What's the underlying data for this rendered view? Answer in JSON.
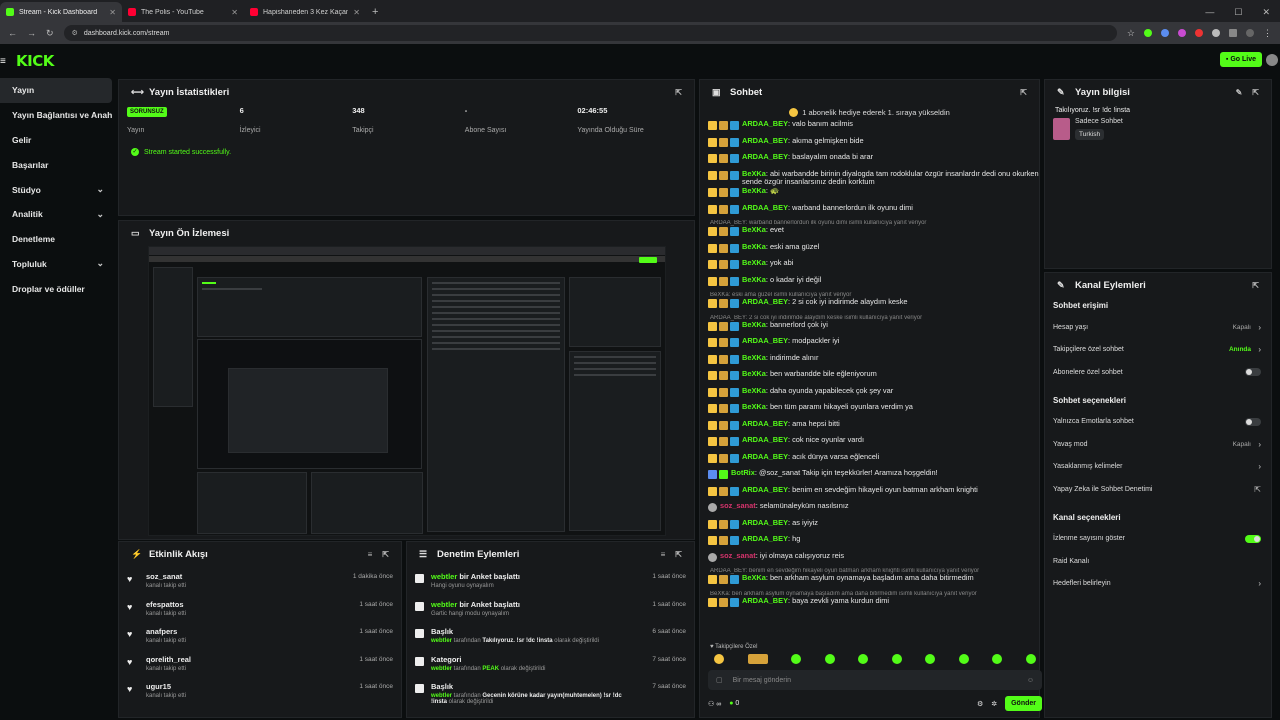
{
  "browser": {
    "tabs": [
      {
        "title": "Stream - Kick Dashboard",
        "color": "#53fc18",
        "active": true
      },
      {
        "title": "The Polis - YouTube",
        "color": "#ff0033",
        "active": false
      },
      {
        "title": "Hapishaneden 3 Kez Kaçan Ad...",
        "color": "#ff0033",
        "active": false
      }
    ],
    "url": "dashboard.kick.com/stream"
  },
  "header": {
    "logo": "KICK",
    "go_live": "Go Live"
  },
  "sidebar": {
    "items": [
      {
        "label": "Yayın",
        "active": true,
        "chevron": false
      },
      {
        "label": "Yayın Bağlantısı ve Anahtarı",
        "chevron": false
      },
      {
        "label": "Gelir",
        "chevron": false
      },
      {
        "label": "Başarılar",
        "chevron": false
      },
      {
        "label": "Stüdyo",
        "chevron": true
      },
      {
        "label": "Analitik",
        "chevron": true
      },
      {
        "label": "Denetleme",
        "chevron": false
      },
      {
        "label": "Topluluk",
        "chevron": true
      },
      {
        "label": "Droplar ve ödüller",
        "chevron": false
      }
    ]
  },
  "stats": {
    "title": "Yayın İstatistikleri",
    "status_badge": "SORUNSUZ",
    "items": [
      {
        "value": "",
        "label": "Yayın"
      },
      {
        "value": "6",
        "label": "İzleyici"
      },
      {
        "value": "348",
        "label": "Takipçi"
      },
      {
        "value": "-",
        "label": "Abone Sayısı"
      },
      {
        "value": "02:46:55",
        "label": "Yayında Olduğu Süre"
      }
    ],
    "success_msg": "Stream started successfully."
  },
  "preview": {
    "title": "Yayın Ön İzlemesi"
  },
  "activity": {
    "title": "Etkinlik Akışı",
    "rows": [
      {
        "name": "soz_sanat",
        "sub": "kanalı takip etti",
        "time": "1 dakika önce"
      },
      {
        "name": "efespattos",
        "sub": "kanalı takip etti",
        "time": "1 saat önce"
      },
      {
        "name": "anafpers",
        "sub": "kanalı takip etti",
        "time": "1 saat önce"
      },
      {
        "name": "qorelith_real",
        "sub": "kanalı takip etti",
        "time": "1 saat önce"
      },
      {
        "name": "ugur15",
        "sub": "kanalı takip etti",
        "time": "1 saat önce"
      }
    ]
  },
  "moderation": {
    "title": "Denetim Eylemleri",
    "rows": [
      {
        "line1_user": "webtler",
        "line1_rest": " bir Anket başlattı",
        "sub": "Hangi oyunu oynayalım",
        "time": "1 saat önce"
      },
      {
        "line1_user": "webtler",
        "line1_rest": " bir Anket başlattı",
        "sub": "Gartic hangi modu oynayalım",
        "time": "1 saat önce"
      },
      {
        "line1_user": "",
        "line1_rest": "Başlık",
        "sub_user": "webtler",
        "sub_mid": " tarafından ",
        "sub_bold": "Takılıyoruz. !sr !dc !insta",
        "sub_end": " olarak değiştirildi",
        "time": "6 saat önce"
      },
      {
        "line1_user": "",
        "line1_rest": "Kategori",
        "sub_user": "webtler",
        "sub_mid": " tarafından ",
        "sub_bold": "PEAK",
        "sub_end": " olarak değiştirildi",
        "time": "7 saat önce"
      },
      {
        "line1_user": "",
        "line1_rest": "Başlık",
        "sub_user": "webtler",
        "sub_mid": " tarafından ",
        "sub_bold": "Gecenin körüne kadar yayın(muhtemelen) !sr !dc !insta",
        "sub_end": " olarak değiştirildi",
        "time": "7 saat önce"
      }
    ]
  },
  "chat": {
    "title": "Sohbet",
    "banner": "1 abonelik hediye ederek 1. sıraya yükseldin",
    "messages": [
      {
        "type": "msg",
        "user": "ARDAA_BEY",
        "cls": "u-a",
        "text": "valo banım acilmis"
      },
      {
        "type": "msg",
        "user": "ARDAA_BEY",
        "cls": "u-a",
        "text": "akıma gelmişken bide"
      },
      {
        "type": "msg",
        "user": "ARDAA_BEY",
        "cls": "u-a",
        "text": "baslayalım onada bi arar"
      },
      {
        "type": "msg",
        "user": "BeXKa",
        "cls": "u-b",
        "text": "abi warbandde birinin diyalogda tam rodoklular özgür insanlardır dedi onu okurken sende özgür insanlarsınız dedin korktum"
      },
      {
        "type": "msg",
        "user": "BeXKa",
        "cls": "u-b",
        "text": "🐢"
      },
      {
        "type": "msg",
        "user": "ARDAA_BEY",
        "cls": "u-a",
        "text": "warband bannerlordun ilk oyunu dimi"
      },
      {
        "type": "reply",
        "text": "ARDAA_BEY: warband bannerlordun ilk oyunu dimi isimli kullanıcıya yanıt veriyor"
      },
      {
        "type": "msg",
        "user": "BeXKa",
        "cls": "u-b",
        "text": "evet"
      },
      {
        "type": "msg",
        "user": "BeXKa",
        "cls": "u-b",
        "text": "eski ama güzel"
      },
      {
        "type": "msg",
        "user": "BeXKa",
        "cls": "u-b",
        "text": "yok abi"
      },
      {
        "type": "msg",
        "user": "BeXKa",
        "cls": "u-b",
        "text": "o kadar iyi değil"
      },
      {
        "type": "reply",
        "text": "BeXKa: eski ama güzel isimli kullanıcıya yanıt veriyor"
      },
      {
        "type": "msg",
        "user": "ARDAA_BEY",
        "cls": "u-a",
        "text": "2 si cok iyi indirimde alaydım keske"
      },
      {
        "type": "reply",
        "text": "ARDAA_BEY: 2 si cok iyi indirimde alaydım keske isimli kullanıcıya yanıt veriyor"
      },
      {
        "type": "msg",
        "user": "BeXKa",
        "cls": "u-b",
        "text": "bannerlord çok iyi"
      },
      {
        "type": "msg",
        "user": "ARDAA_BEY",
        "cls": "u-a",
        "text": "modpackler iyi"
      },
      {
        "type": "msg",
        "user": "BeXKa",
        "cls": "u-b",
        "text": "indirimde alınır"
      },
      {
        "type": "msg",
        "user": "BeXKa",
        "cls": "u-b",
        "text": "ben warbandde bile eğleniyorum"
      },
      {
        "type": "msg",
        "user": "BeXKa",
        "cls": "u-b",
        "text": "daha oyunda yapabilecek çok şey var"
      },
      {
        "type": "msg",
        "user": "BeXKa",
        "cls": "u-b",
        "text": "ben tüm paramı hikayeli oyunlara verdim ya"
      },
      {
        "type": "msg",
        "user": "ARDAA_BEY",
        "cls": "u-a",
        "text": "ama hepsi bitti"
      },
      {
        "type": "msg",
        "user": "ARDAA_BEY",
        "cls": "u-a",
        "text": "cok nice oyunlar vardı"
      },
      {
        "type": "msg",
        "user": "ARDAA_BEY",
        "cls": "u-a",
        "text": "acık dünya varsa eğlenceli"
      },
      {
        "type": "msg",
        "user": "BotRix",
        "cls": "u-bot",
        "text": "@soz_sanat Takip için teşekkürler! Aramıza hoşgeldin!"
      },
      {
        "type": "msg",
        "user": "ARDAA_BEY",
        "cls": "u-a",
        "text": "benim en sevdeğim hikayeli oyun batman arkham knighti"
      },
      {
        "type": "msg",
        "user": "soz_sanat",
        "cls": "u-s",
        "text": "selamünaleyküm nasılsınız"
      },
      {
        "type": "msg",
        "user": "ARDAA_BEY",
        "cls": "u-a",
        "text": "as iyiyiz"
      },
      {
        "type": "msg",
        "user": "ARDAA_BEY",
        "cls": "u-a",
        "text": "hg"
      },
      {
        "type": "msg",
        "user": "soz_sanat",
        "cls": "u-s",
        "text": "iyi olmaya calışıyoruz reis"
      },
      {
        "type": "reply",
        "text": "ARDAA_BEY: benim en sevdeğim hikayeli oyun batman arkham knighti isimli kullanıcıya yanıt veriyor"
      },
      {
        "type": "msg",
        "user": "BeXKa",
        "cls": "u-b",
        "text": "ben arkham asylum oynamaya başladım ama daha bitirmedim"
      },
      {
        "type": "reply",
        "text": "BeXKa: ben arkham asylum oynamaya başladım ama daha bitirmedim isimli kullanıcıya yanıt veriyor"
      },
      {
        "type": "msg",
        "user": "ARDAA_BEY",
        "cls": "u-a",
        "text": "baya zevkli yama kurdun dimi"
      }
    ],
    "followers_only": "Takipçilere Özel",
    "placeholder": "Bir mesaj gönderin",
    "viewers": "0",
    "send_label": "Gönder"
  },
  "info": {
    "title": "Yayın bilgisi",
    "stream_title": "Takılıyoruz. !sr !dc !insta",
    "category": "Sadece Sohbet",
    "tag": "Turkish"
  },
  "channel_actions": {
    "title": "Kanal Eylemleri",
    "chat_access_title": "Sohbet erişimi",
    "chat_access": [
      {
        "label": "Hesap yaşı",
        "value": "Kapalı",
        "kind": "chev"
      },
      {
        "label": "Takipçilere özel sohbet",
        "value": "Anında",
        "kind": "chev",
        "green": true
      },
      {
        "label": "Abonelere özel sohbet",
        "kind": "toggle",
        "on": false
      }
    ],
    "chat_options_title": "Sohbet seçenekleri",
    "chat_options": [
      {
        "label": "Yalnızca Emotlarla sohbet",
        "kind": "toggle",
        "on": false
      },
      {
        "label": "Yavaş mod",
        "value": "Kapalı",
        "kind": "chev"
      },
      {
        "label": "Yasaklanmış kelimeler",
        "kind": "chev"
      },
      {
        "label": "Yapay Zeka ile Sohbet Denetimi",
        "kind": "ext"
      }
    ],
    "channel_options_title": "Kanal seçenekleri",
    "channel_options": [
      {
        "label": "İzlenme sayısını göster",
        "kind": "toggle",
        "on": true
      },
      {
        "label": "Raid Kanalı",
        "kind": "none"
      },
      {
        "label": "Hedefleri belirleyin",
        "kind": "chev"
      }
    ]
  },
  "colors": {
    "accent": "#53fc18",
    "panel": "#17191b",
    "bg": "#0b0e0f"
  }
}
